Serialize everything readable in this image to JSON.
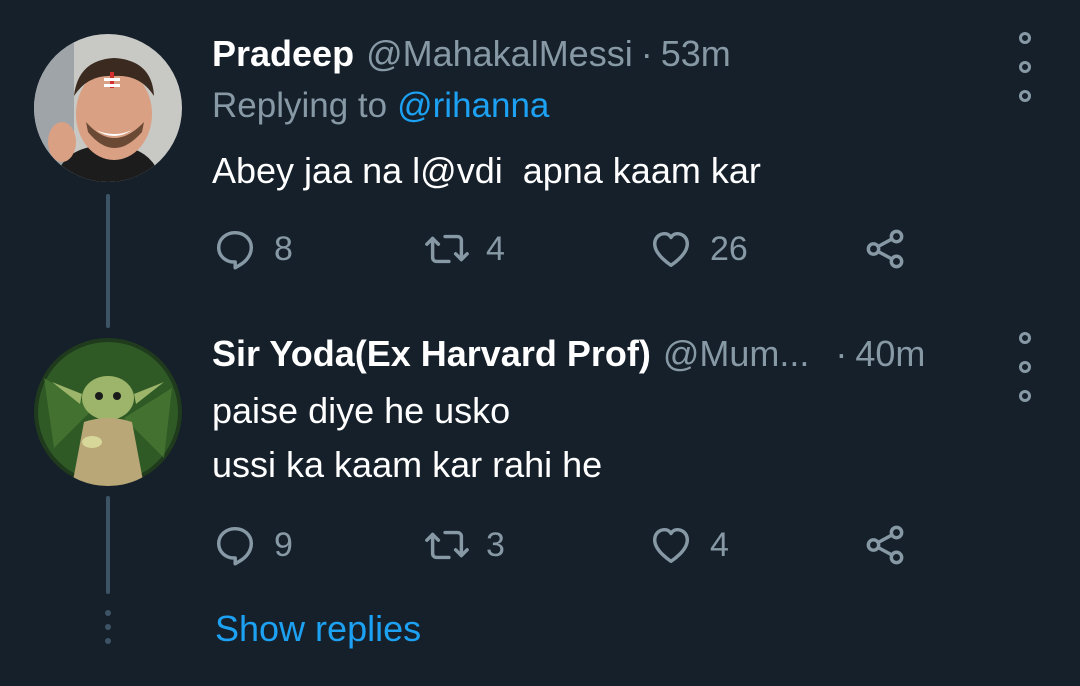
{
  "tweets": [
    {
      "name": "Pradeep",
      "handle": "@MahakalMessi",
      "separator": "·",
      "time": "53m",
      "replying_prefix": "Replying to",
      "replying_to": "@rihanna",
      "lines": [
        "Abey jaa na l@vdi  apna kaam kar"
      ],
      "replies": "8",
      "retweets": "4",
      "likes": "26"
    },
    {
      "name": "Sir Yoda(Ex Harvard Prof)",
      "handle": "@Mum...",
      "separator": "·",
      "time": "40m",
      "lines": [
        "paise diye he usko",
        "ussi ka kaam kar rahi he"
      ],
      "replies": "9",
      "retweets": "3",
      "likes": "4"
    }
  ],
  "show_replies": "Show replies",
  "icons": [
    "reply-icon",
    "retweet-icon",
    "like-icon",
    "share-icon",
    "more-options-icon"
  ],
  "colors": {
    "background": "#15202b",
    "secondary": "#8899a6",
    "accent": "#1da1f2",
    "thread": "#3d5466"
  }
}
